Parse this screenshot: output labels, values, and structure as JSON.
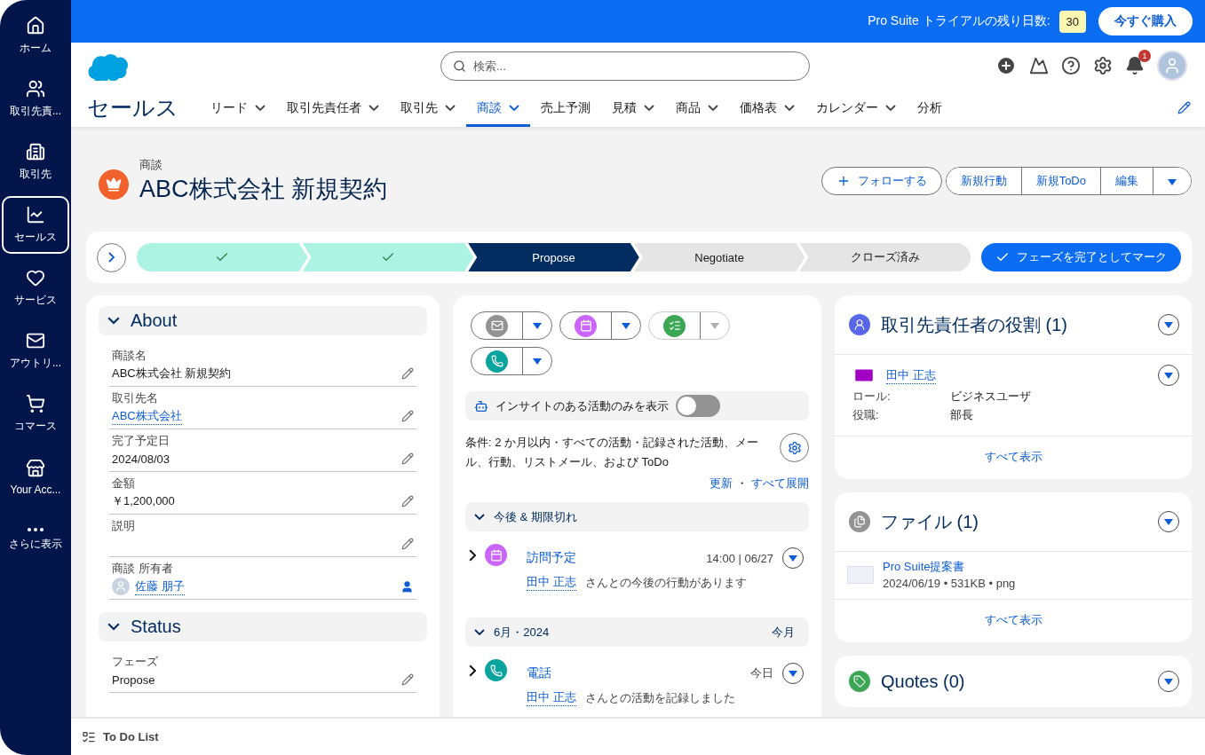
{
  "sidebar": {
    "items": [
      {
        "label": "ホーム",
        "selected": false
      },
      {
        "label": "取引先責...",
        "selected": false
      },
      {
        "label": "取引先",
        "selected": false
      },
      {
        "label": "セールス",
        "selected": true
      },
      {
        "label": "サービス",
        "selected": false
      },
      {
        "label": "アウトリ...",
        "selected": false
      },
      {
        "label": "コマース",
        "selected": false
      },
      {
        "label": "Your Acc...",
        "selected": false
      },
      {
        "label": "さらに表示",
        "selected": false
      }
    ]
  },
  "trial_bar": {
    "text": "Pro Suite トライアルの残り日数:",
    "days": "30",
    "button": "今すぐ購入"
  },
  "header": {
    "search": {
      "placeholder": "検索..."
    },
    "notification_count": "1"
  },
  "nav": {
    "app_name": "セールス",
    "items": [
      {
        "label": "リード",
        "has_menu": true,
        "selected": false
      },
      {
        "label": "取引先責任者",
        "has_menu": true,
        "selected": false
      },
      {
        "label": "取引先",
        "has_menu": true,
        "selected": false
      },
      {
        "label": "商談",
        "has_menu": true,
        "selected": true
      },
      {
        "label": "売上予測",
        "has_menu": false,
        "selected": false
      },
      {
        "label": "見積",
        "has_menu": true,
        "selected": false
      },
      {
        "label": "商品",
        "has_menu": true,
        "selected": false
      },
      {
        "label": "価格表",
        "has_menu": true,
        "selected": false
      },
      {
        "label": "カレンダー",
        "has_menu": true,
        "selected": false
      },
      {
        "label": "分析",
        "has_menu": false,
        "selected": false
      }
    ]
  },
  "record": {
    "object_label": "商談",
    "title": "ABC株式会社 新規契約",
    "follow_button": "フォローする",
    "actions": [
      "新規行動",
      "新規ToDo",
      "編集"
    ]
  },
  "path": {
    "stages": [
      {
        "kind": "complete"
      },
      {
        "kind": "complete"
      },
      {
        "label": "Propose",
        "kind": "current"
      },
      {
        "label": "Negotiate",
        "kind": "incomplete"
      },
      {
        "label": "クローズ済み",
        "kind": "incomplete"
      }
    ],
    "mark_button": "フェーズを完了としてマーク"
  },
  "details": {
    "sections": [
      {
        "title": "About",
        "expanded": true,
        "fields": [
          {
            "label": "商談名",
            "value": "ABC株式会社 新規契約",
            "kind": "text"
          },
          {
            "label": "取引先名",
            "value": "ABC株式会社",
            "kind": "link"
          },
          {
            "label": "完了予定日",
            "value": "2024/08/03",
            "kind": "text"
          },
          {
            "label": "金額",
            "value": "￥1,200,000",
            "kind": "text"
          },
          {
            "label": "説明",
            "kind": "text"
          },
          {
            "label": "商談 所有者",
            "value": "佐藤 朋子",
            "kind": "owner"
          }
        ]
      },
      {
        "title": "Status",
        "expanded": true,
        "fields": [
          {
            "label": "フェーズ",
            "value": "Propose",
            "kind": "text"
          }
        ]
      }
    ]
  },
  "activity": {
    "composer_buttons": [
      {
        "kind": "email",
        "disabled": false
      },
      {
        "kind": "event",
        "disabled": false
      },
      {
        "kind": "task",
        "disabled": true
      },
      {
        "kind": "call",
        "disabled": false
      }
    ],
    "insights_toggle": {
      "label": "インサイトのある活動のみを表示",
      "on": false
    },
    "filter_text": "条件: 2 か月以内・すべての活動・記録された活動、メール、行動、リストメール、および ToDo",
    "links": [
      "更新",
      "すべて展開"
    ],
    "link_separator": "・",
    "groups": [
      {
        "title": "今後 & 期限切れ",
        "expanded": true,
        "items": [
          {
            "kind": "event",
            "expanded": false,
            "title": "訪問予定",
            "time": "14:00 | 06/27",
            "person": "田中 正志",
            "text": "さんとの今後の行動があります"
          }
        ]
      },
      {
        "title": "6月・2024",
        "badge": "今月",
        "expanded": true,
        "items": [
          {
            "kind": "call",
            "expanded": false,
            "title": "電話",
            "time": "今日",
            "person": "田中 正志",
            "text": "さんとの活動を記録しました"
          }
        ]
      }
    ]
  },
  "related": {
    "contact_roles": {
      "title": "取引先責任者の役割 (1)",
      "contact": {
        "name": "田中 正志",
        "fields": [
          {
            "label": "ロール:",
            "value": "ビジネスユーザ"
          },
          {
            "label": "役職:",
            "value": "部長"
          }
        ]
      },
      "view_all": "すべて表示"
    },
    "files": {
      "title": "ファイル (1)",
      "file": {
        "name": "Pro Suite提案書",
        "meta": "2024/06/19 • 531KB • png"
      },
      "view_all": "すべて表示"
    },
    "quotes": {
      "title": "Quotes (0)"
    }
  },
  "utility_bar": {
    "label": "To Do List"
  }
}
